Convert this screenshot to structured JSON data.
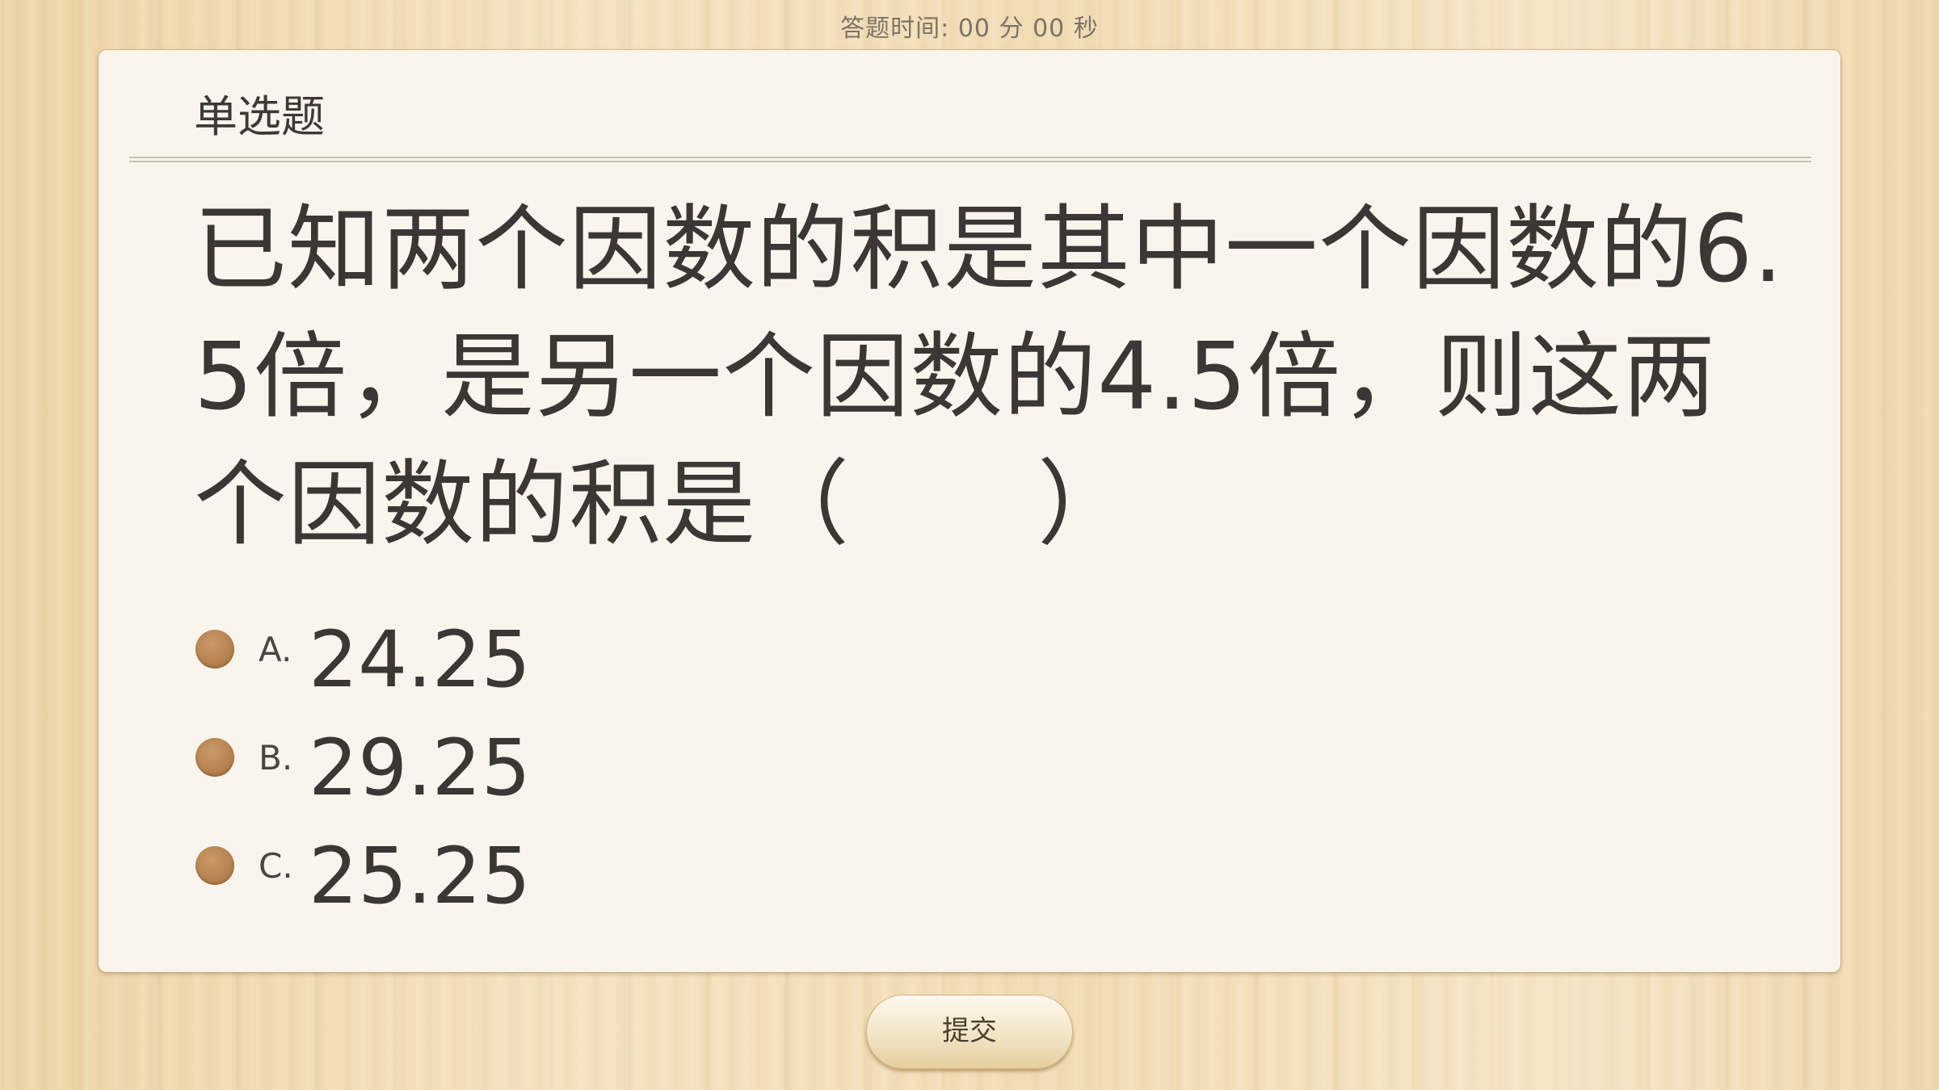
{
  "header": {
    "timer_label": "答题时间:",
    "timer_minutes": "00",
    "minutes_unit": "分",
    "timer_seconds": "00",
    "seconds_unit": "秒"
  },
  "question": {
    "type": "单选题",
    "text": "已知两个因数的积是其中一个因数的6.5倍，是另一个因数的4.5倍，则这两个因数的积是（　　）",
    "options": [
      {
        "letter": "A.",
        "text": "24.25"
      },
      {
        "letter": "B.",
        "text": "29.25"
      },
      {
        "letter": "C.",
        "text": "25.25"
      }
    ]
  },
  "footer": {
    "submit_label": "提交"
  },
  "colors": {
    "radio": "#b5814f",
    "card": "#f9f5ec",
    "background": "#f1dcb4"
  }
}
